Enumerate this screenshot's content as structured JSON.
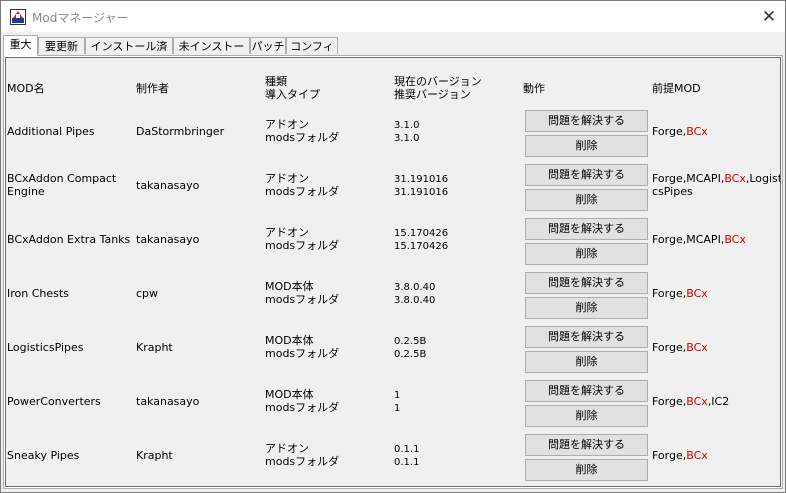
{
  "window": {
    "title": "Modマネージャー"
  },
  "tabs": [
    "重大",
    "要更新",
    "インストール済み",
    "未インストール",
    "パッチ",
    "コンフィグ"
  ],
  "active_tab": 0,
  "headers": {
    "mod_name": "MOD名",
    "author": "制作者",
    "type_line1": "種類",
    "type_line2": "導入タイプ",
    "version_line1": "現在のバージョン",
    "version_line2": "推奨バージョン",
    "action": "動作",
    "prereq": "前提MOD"
  },
  "buttons": {
    "resolve": "問題を解決する",
    "delete": "削除"
  },
  "colors": {
    "missing_prereq": "#d00000"
  },
  "rows": [
    {
      "name": "Additional Pipes",
      "author": "DaStormbringer",
      "type": "アドオン",
      "install": "modsフォルダ",
      "current": "3.1.0",
      "recommended": "3.1.0",
      "prereq_line1": [
        {
          "text": "Forge,",
          "missing": false
        },
        {
          "text": "BCx",
          "missing": true
        }
      ],
      "prereq_line2": []
    },
    {
      "name": "BCxAddon Compact Engine",
      "author": "takanasayo",
      "type": "アドオン",
      "install": "modsフォルダ",
      "current": "31.191016",
      "recommended": "31.191016",
      "prereq_line1": [
        {
          "text": "Forge,MCAPI,",
          "missing": false
        },
        {
          "text": "BCx",
          "missing": true
        },
        {
          "text": ",Logisti",
          "missing": false
        }
      ],
      "prereq_line2": [
        {
          "text": "csPipes",
          "missing": false
        }
      ]
    },
    {
      "name": "BCxAddon Extra Tanks",
      "author": "takanasayo",
      "type": "アドオン",
      "install": "modsフォルダ",
      "current": "15.170426",
      "recommended": "15.170426",
      "prereq_line1": [
        {
          "text": "Forge,MCAPI,",
          "missing": false
        },
        {
          "text": "BCx",
          "missing": true
        }
      ],
      "prereq_line2": []
    },
    {
      "name": "Iron Chests",
      "author": "cpw",
      "type": "MOD本体",
      "install": "modsフォルダ",
      "current": "3.8.0.40",
      "recommended": "3.8.0.40",
      "prereq_line1": [
        {
          "text": "Forge,",
          "missing": false
        },
        {
          "text": "BCx",
          "missing": true
        }
      ],
      "prereq_line2": []
    },
    {
      "name": "LogisticsPipes",
      "author": "Krapht",
      "type": "MOD本体",
      "install": "modsフォルダ",
      "current": "0.2.5B",
      "recommended": "0.2.5B",
      "prereq_line1": [
        {
          "text": "Forge,",
          "missing": false
        },
        {
          "text": "BCx",
          "missing": true
        }
      ],
      "prereq_line2": []
    },
    {
      "name": "PowerConverters",
      "author": "takanasayo",
      "type": "MOD本体",
      "install": "modsフォルダ",
      "current": "1",
      "recommended": "1",
      "prereq_line1": [
        {
          "text": "Forge,",
          "missing": false
        },
        {
          "text": "BCx",
          "missing": true
        },
        {
          "text": ",IC2",
          "missing": false
        }
      ],
      "prereq_line2": []
    },
    {
      "name": "Sneaky Pipes",
      "author": "Krapht",
      "type": "アドオン",
      "install": "modsフォルダ",
      "current": "0.1.1",
      "recommended": "0.1.1",
      "prereq_line1": [
        {
          "text": "Forge,",
          "missing": false
        },
        {
          "text": "BCx",
          "missing": true
        }
      ],
      "prereq_line2": []
    }
  ]
}
